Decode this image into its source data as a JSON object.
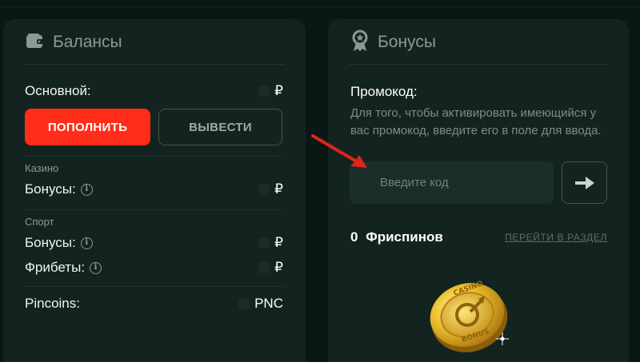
{
  "balances": {
    "title": "Балансы",
    "main_label": "Основной:",
    "main_value": "₽",
    "deposit_label": "ПОПОЛНИТЬ",
    "withdraw_label": "ВЫВЕСТИ",
    "casino_section": "Казино",
    "casino_bonus_label": "Бонусы:",
    "casino_bonus_value": "₽",
    "sport_section": "Спорт",
    "sport_bonus_label": "Бонусы:",
    "sport_bonus_value": "₽",
    "freebets_label": "Фрибеты:",
    "freebets_value": "₽",
    "pincoins_label": "Pincoins:",
    "pincoins_value": "PNC",
    "info_glyph": "i"
  },
  "bonuses": {
    "title": "Бонусы",
    "promo_title": "Промокод:",
    "promo_description": "Для того, чтобы активировать имеющийся у вас промокод, введите его в поле для ввода.",
    "promo_placeholder": "Введите код",
    "freespins_count": "0",
    "freespins_label": "Фриспинов",
    "goto_section_label": "ПЕРЕЙТИ В РАЗДЕЛ",
    "coin_top_text": "CASINO",
    "coin_bottom_text": "BONUS"
  },
  "icons": {
    "wallet": "wallet-icon",
    "badge": "award-badge-icon",
    "submit": "arrow-right-icon",
    "pointer": "red-pointer-arrow"
  },
  "colors": {
    "background": "#0b1714",
    "card": "#132420",
    "accent_red": "#ff2d1a",
    "muted_text": "#8a9b95",
    "pointer_red": "#e2231a",
    "coin_gold": "#e9b525"
  }
}
